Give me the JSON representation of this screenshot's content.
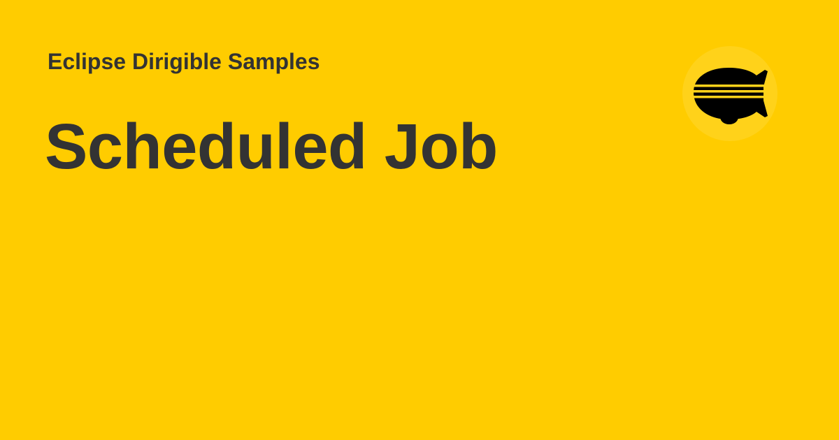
{
  "card": {
    "site_name": "Eclipse Dirigible Samples",
    "title": "Scheduled Job"
  },
  "logo": {
    "icon": "dirigible-airship-icon"
  },
  "colors": {
    "background": "#FFCC00",
    "text": "#333333",
    "logo_halo": "#FFD21A",
    "logo_fill": "#000000"
  }
}
